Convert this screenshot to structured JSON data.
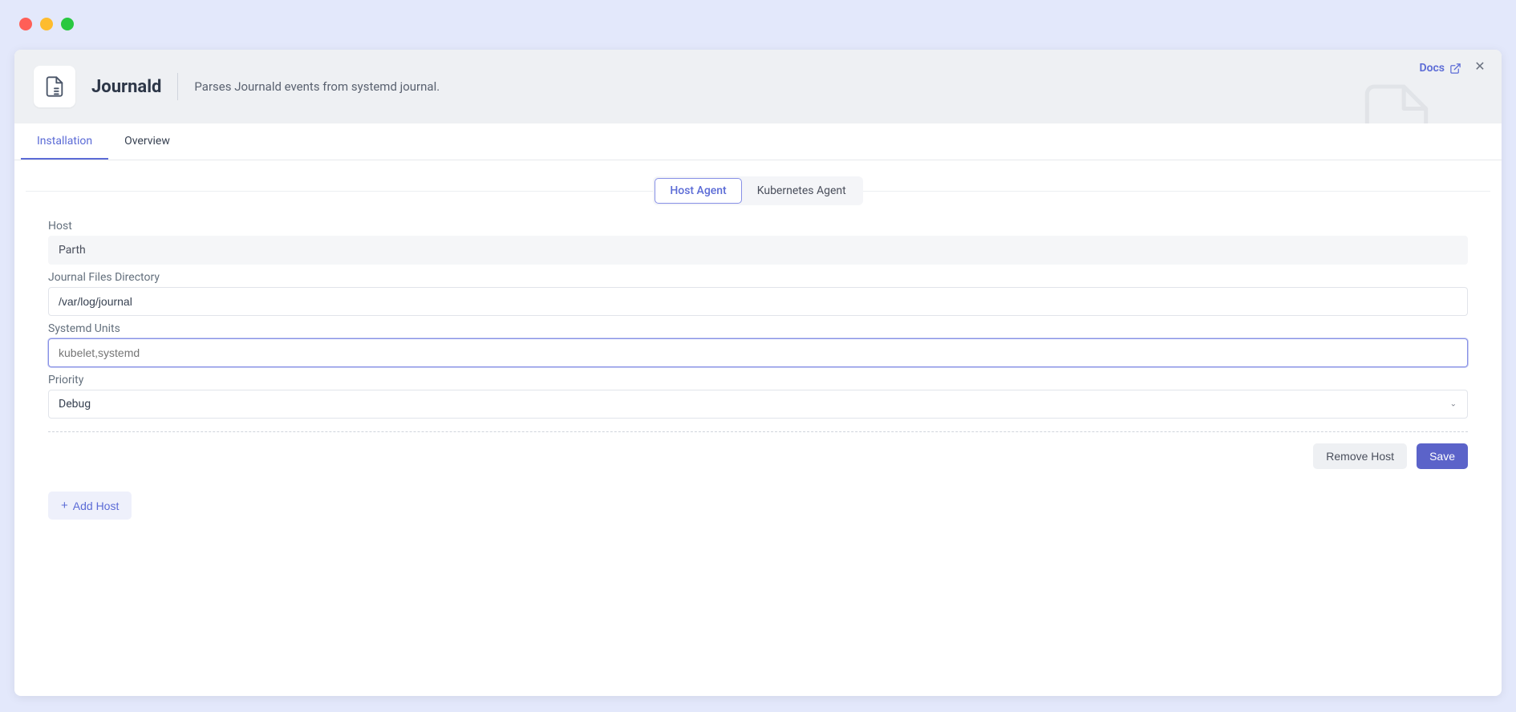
{
  "header": {
    "title": "Journald",
    "subtitle": "Parses Journald events from systemd journal.",
    "docs_label": "Docs"
  },
  "tabs": {
    "installation": "Installation",
    "overview": "Overview"
  },
  "agent_toggle": {
    "host": "Host Agent",
    "kubernetes": "Kubernetes Agent"
  },
  "form": {
    "host_label": "Host",
    "host_value": "Parth",
    "journal_dir_label": "Journal Files Directory",
    "journal_dir_value": "/var/log/journal",
    "systemd_units_label": "Systemd Units",
    "systemd_units_placeholder": "kubelet,systemd",
    "priority_label": "Priority",
    "priority_value": "Debug"
  },
  "buttons": {
    "remove_host": "Remove Host",
    "save": "Save",
    "add_host": "Add Host"
  }
}
